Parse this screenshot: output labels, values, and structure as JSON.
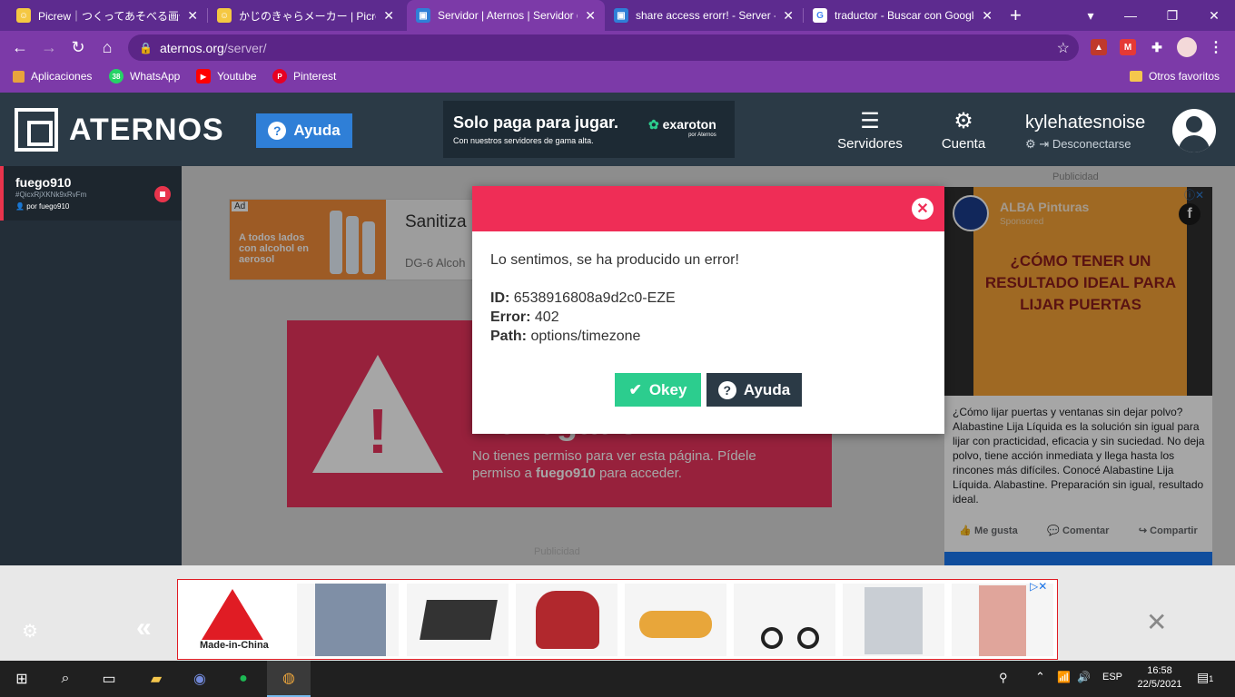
{
  "browser": {
    "tabs": [
      {
        "title": "Picrew｜つくってあそべる画像メーカー",
        "active": false,
        "favicon_color": "#f5c842"
      },
      {
        "title": "かじのきゃらメーカー | Picrew",
        "active": false,
        "favicon_color": "#f5c842"
      },
      {
        "title": "Servidor | Aternos | Servidor de Minecraft gratis",
        "active": true,
        "favicon_color": "#2f7fd7"
      },
      {
        "title": "share access erorr! - Server - Aternos",
        "active": false,
        "favicon_color": "#2f7fd7"
      },
      {
        "title": "traductor - Buscar con Google",
        "active": false,
        "favicon_color": "#ffffff"
      }
    ],
    "new_tab": "+",
    "address": {
      "domain": "aternos.org",
      "path": "/server/"
    },
    "bookmarks": [
      {
        "label": "Aplicaciones",
        "color": "#e8a33c"
      },
      {
        "label": "WhatsApp",
        "color": "#25d366",
        "badge": "38"
      },
      {
        "label": "Youtube",
        "color": "#ff0000"
      },
      {
        "label": "Pinterest",
        "color": "#e60023"
      }
    ],
    "other_bookmarks": "Otros favoritos"
  },
  "header": {
    "logo_text": "ATERNOS",
    "help_label": "Ayuda",
    "ad": {
      "headline": "Solo paga para jugar.",
      "sub": "Con nuestros servidores de gama alta.",
      "brand": "exaroton",
      "brand_sub": "por Aternos"
    },
    "nav": [
      {
        "label": "Servidores",
        "icon": "servers-icon"
      },
      {
        "label": "Cuenta",
        "icon": "account-icon"
      }
    ],
    "user": {
      "name": "kylehatesnoise",
      "logout": "Desconectarse"
    }
  },
  "sidebar": {
    "server": {
      "name": "fuego910",
      "id": "#QicxRjXKNk9xRvFm",
      "owner": "por fuego910"
    }
  },
  "content": {
    "ad_title": "Sanitiza",
    "ad_sub": "DG-6 Alcoh",
    "ad_img_text": "A todos lados con alcohol en aerosol",
    "ad_badge": "Ad",
    "banner_title": "Denegado",
    "banner_msg_pre": "No tienes permiso para ver esta página. Pídele permiso a ",
    "banner_owner": "fuego910",
    "banner_msg_post": " para acceder.",
    "publicidad": "Publicidad"
  },
  "fb_ad": {
    "page": "ALBA Pinturas",
    "sponsored": "Sponsored",
    "image_title": "¿CÓMO TENER UN RESULTADO IDEAL PARA LIJAR PUERTAS",
    "body": "¿Cómo lijar puertas y ventanas sin dejar polvo? Alabastine Lija Líquida es la solución sin igual para lijar con practicidad, eficacia y sin suciedad. No deja polvo, tiene acción inmediata y llega hasta los rincones más difíciles. Conocé Alabastine Lija Líquida. Alabastine. Preparación sin igual, resultado ideal.",
    "like": "Me gusta",
    "comment": "Comentar",
    "share": "Compartir"
  },
  "modal": {
    "message": "Lo sentimos, se ha producido un error!",
    "id_label": "ID:",
    "id_value": "6538916808a9d2c0-EZE",
    "error_label": "Error:",
    "error_value": "402",
    "path_label": "Path:",
    "path_value": "options/timezone",
    "ok_label": "Okey",
    "help_label": "Ayuda"
  },
  "bottom_ad": {
    "brand": "Made-in-China"
  },
  "taskbar": {
    "lang": "ESP",
    "time": "16:58",
    "date": "22/5/2021",
    "notifications": "1"
  }
}
